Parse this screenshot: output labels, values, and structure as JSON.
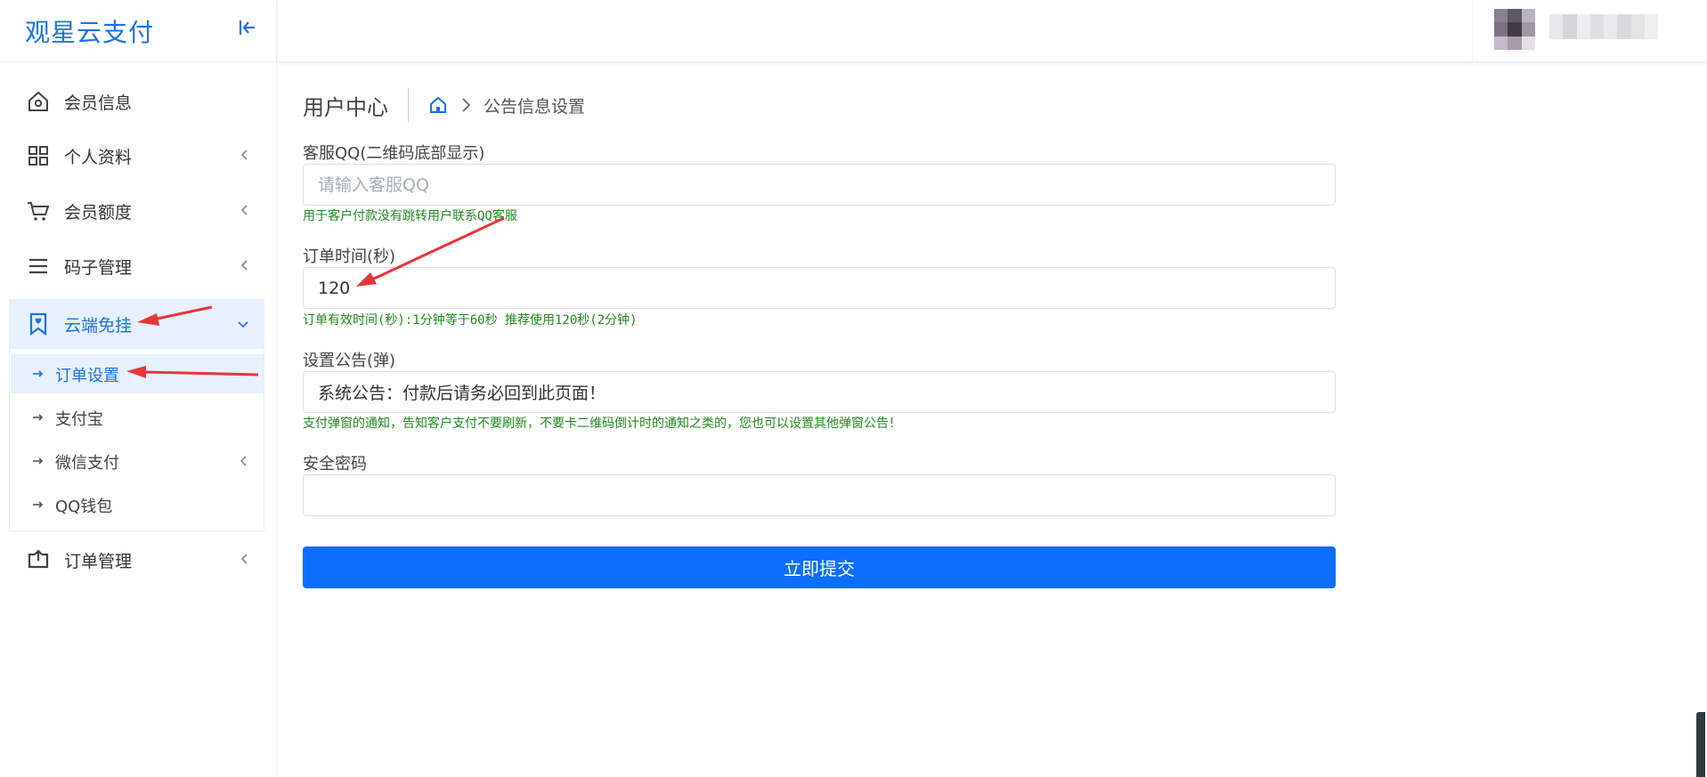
{
  "app": {
    "title": "观星云支付"
  },
  "sidebar": {
    "items": [
      {
        "label": "会员信息",
        "icon": "home-icon"
      },
      {
        "label": "个人资料",
        "icon": "grid-icon"
      },
      {
        "label": "会员额度",
        "icon": "cart-icon"
      },
      {
        "label": "码子管理",
        "icon": "menu-icon"
      },
      {
        "label": "云端免挂",
        "icon": "bookmark-heart-icon"
      },
      {
        "label": "订单管理",
        "icon": "box-arrow-icon"
      }
    ],
    "submenu": [
      {
        "label": "订单设置"
      },
      {
        "label": "支付宝"
      },
      {
        "label": "微信支付"
      },
      {
        "label": "QQ钱包"
      }
    ]
  },
  "header": {
    "page_title": "用户中心",
    "breadcrumb_current": "公告信息设置"
  },
  "form": {
    "fields": [
      {
        "label": "客服QQ(二维码底部显示)",
        "value": "",
        "placeholder": "请输入客服QQ",
        "help": "用于客户付款没有跳转用户联系QQ客服"
      },
      {
        "label": "订单时间(秒)",
        "value": "120",
        "placeholder": "",
        "help": "订单有效时间(秒):1分钟等于60秒 推荐使用120秒(2分钟)"
      },
      {
        "label": "设置公告(弹)",
        "value": "系统公告：付款后请务必回到此页面！",
        "placeholder": "",
        "help": "支付弹窗的通知，告知客户支付不要刷新，不要卡二维码倒计时的通知之类的，您也可以设置其他弹窗公告！"
      },
      {
        "label": "安全密码",
        "value": "",
        "placeholder": ""
      }
    ],
    "submit_label": "立即提交"
  },
  "colors": {
    "brand": "#1a73e8",
    "primary_button": "#0d6efd",
    "help_text": "#1f8a1f",
    "active_bg": "#e7f0fe",
    "annotation_arrow": "#e8353a"
  }
}
